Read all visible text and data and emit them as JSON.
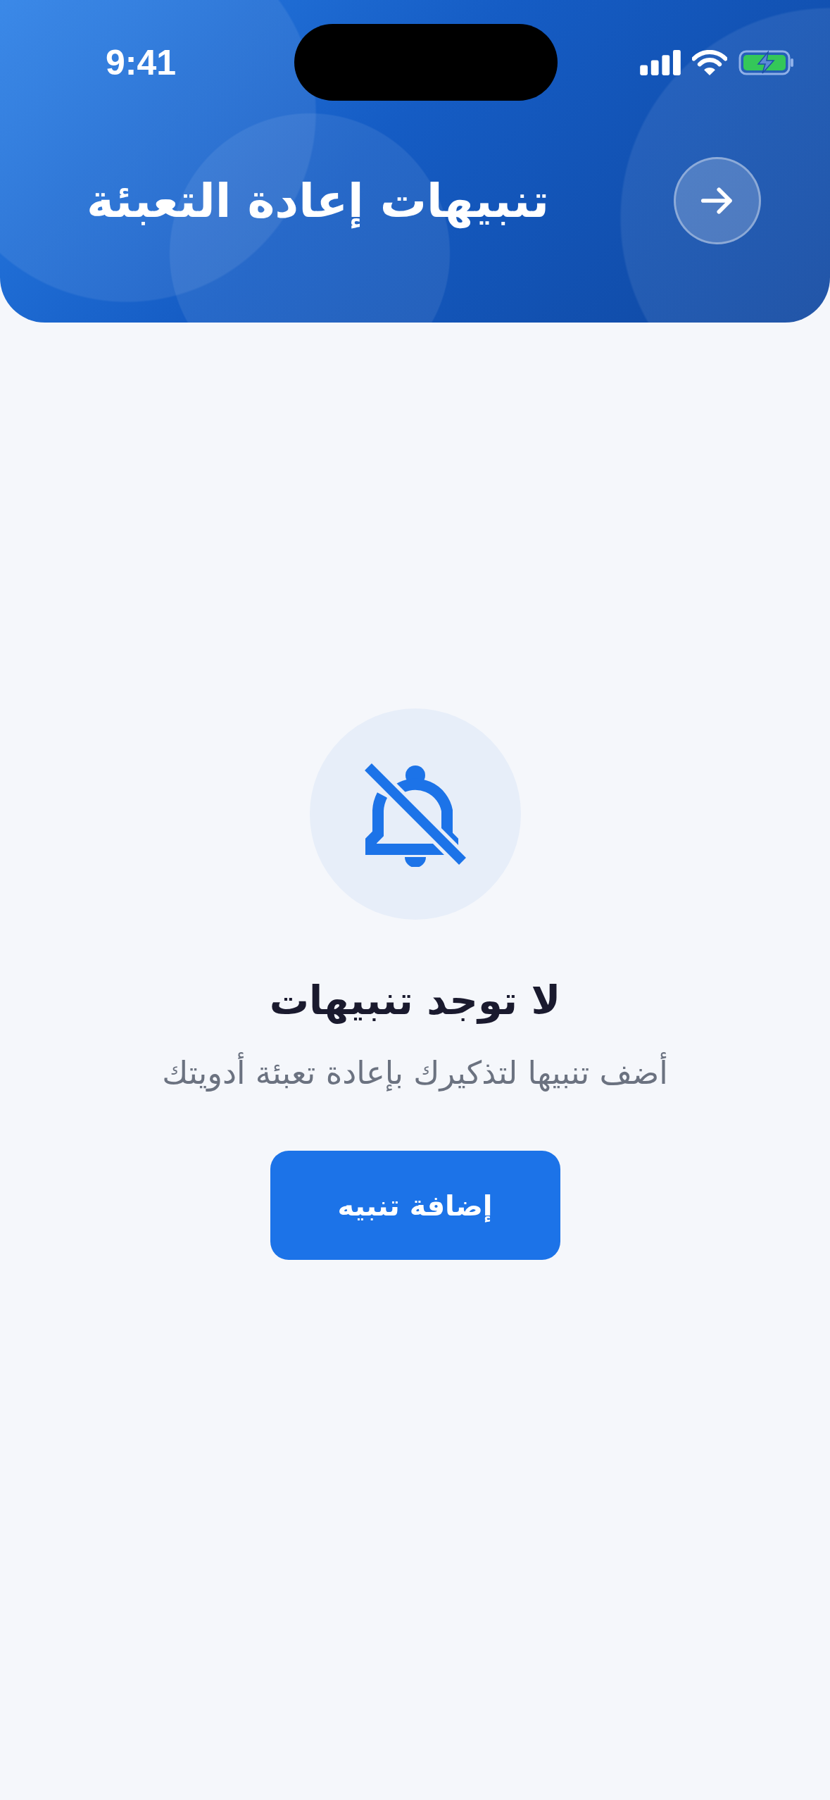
{
  "status_bar": {
    "time": "9:41"
  },
  "header": {
    "title": "تنبيهات إعادة التعبئة"
  },
  "empty_state": {
    "title": "لا توجد تنبيهات",
    "message": "أضف تنبيها لتذكيرك بإعادة تعبئة أدويتك",
    "button": "إضافة تنبيه"
  }
}
